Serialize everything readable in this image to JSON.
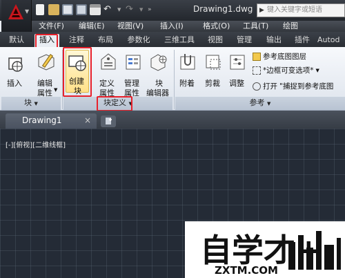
{
  "title_bar": {
    "doc_title": "Drawing1.dwg",
    "search_placeholder": "键入关键字或短语"
  },
  "menu": [
    "文件(F)",
    "编辑(E)",
    "视图(V)",
    "插入(I)",
    "格式(O)",
    "工具(T)",
    "绘图"
  ],
  "ribbon_tabs": [
    "默认",
    "插入",
    "注释",
    "布局",
    "参数化",
    "三维工具",
    "视图",
    "管理",
    "输出",
    "插件",
    "Autod"
  ],
  "active_tab": "插入",
  "ribbon": {
    "insert": "插入",
    "edit_attr": [
      "编辑",
      "属性"
    ],
    "create_block": [
      "创建",
      "块"
    ],
    "define_attr": [
      "定义",
      "属性"
    ],
    "manage_attr": [
      "管理",
      "属性"
    ],
    "block_editor": [
      "块",
      "编辑器"
    ],
    "attach": "附着",
    "clip": "剪裁",
    "adjust": "调整",
    "ref_layers": "参考底图图层",
    "frame_var": "*边框可变选项*",
    "open_label": "打开",
    "snap_ref": "\"捕捉到参考底图",
    "panel_block": "块",
    "panel_block_def": "块定义",
    "panel_reference": "参考"
  },
  "file_tabs": {
    "drawing": "Drawing1",
    "close": "×"
  },
  "viewport_label": "[-][俯视][二维线框]",
  "watermark": {
    "text": "ZXTM.COM",
    "logo_chars": "自学才+"
  },
  "colors": {
    "highlight_red": "#e8202a",
    "canvas_bg": "#242b36",
    "titlebar": "#2a2e34"
  }
}
